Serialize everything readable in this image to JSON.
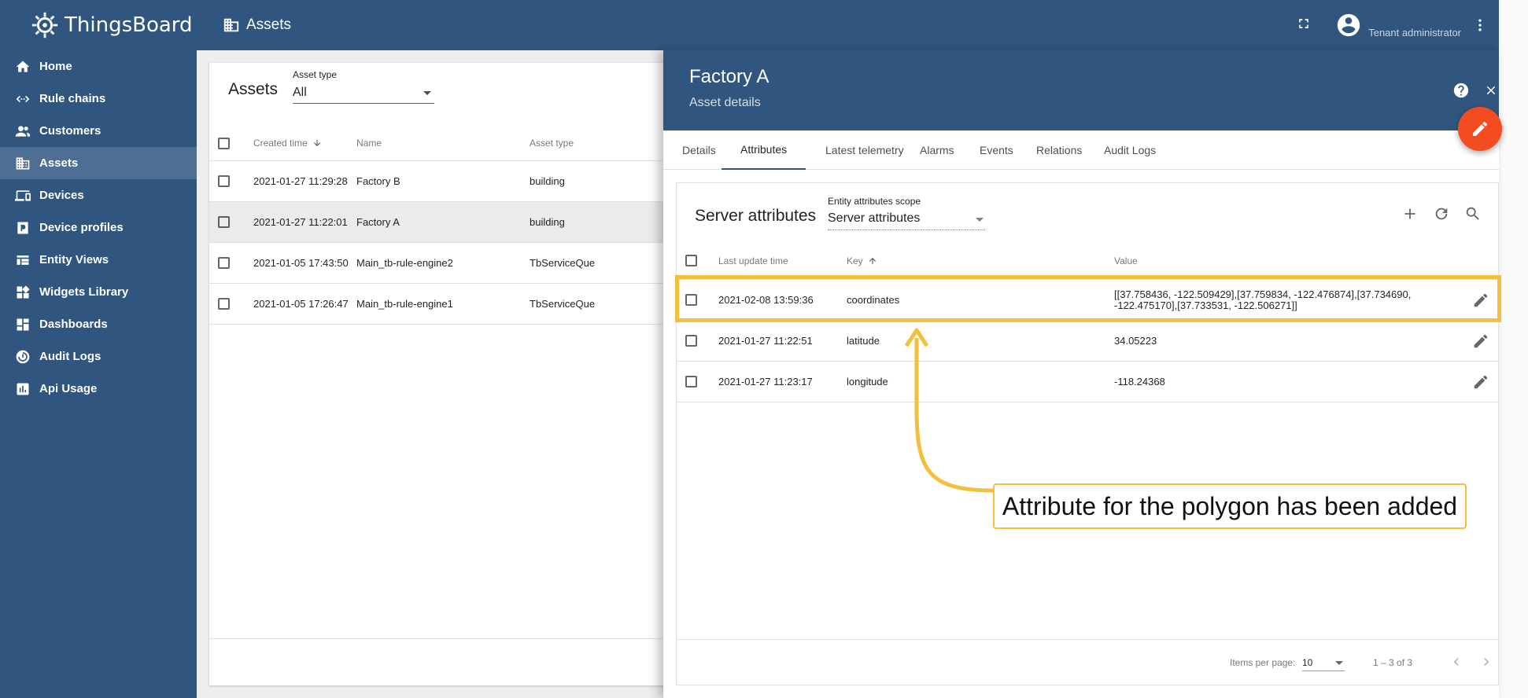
{
  "app": {
    "name": "ThingsBoard",
    "page_title": "Assets",
    "user_role": "Tenant administrator"
  },
  "sidebar": {
    "items": [
      {
        "label": "Home",
        "icon": "home-icon"
      },
      {
        "label": "Rule chains",
        "icon": "rule-chains-icon"
      },
      {
        "label": "Customers",
        "icon": "customers-icon"
      },
      {
        "label": "Assets",
        "icon": "assets-icon",
        "active": true
      },
      {
        "label": "Devices",
        "icon": "devices-icon"
      },
      {
        "label": "Device profiles",
        "icon": "device-profiles-icon"
      },
      {
        "label": "Entity Views",
        "icon": "entity-views-icon"
      },
      {
        "label": "Widgets Library",
        "icon": "widgets-library-icon"
      },
      {
        "label": "Dashboards",
        "icon": "dashboards-icon"
      },
      {
        "label": "Audit Logs",
        "icon": "audit-logs-icon"
      },
      {
        "label": "Api Usage",
        "icon": "api-usage-icon"
      }
    ]
  },
  "assets": {
    "title": "Assets",
    "type_label": "Asset type",
    "type_value": "All",
    "columns": [
      "Created time",
      "Name",
      "Asset type"
    ],
    "rows": [
      {
        "created": "2021-01-27 11:29:28",
        "name": "Factory B",
        "type": "building"
      },
      {
        "created": "2021-01-27 11:22:01",
        "name": "Factory A",
        "type": "building"
      },
      {
        "created": "2021-01-05 17:43:50",
        "name": "Main_tb-rule-engine2",
        "type": "TbServiceQue"
      },
      {
        "created": "2021-01-05 17:26:47",
        "name": "Main_tb-rule-engine1",
        "type": "TbServiceQue"
      }
    ]
  },
  "details": {
    "title": "Factory A",
    "subtitle": "Asset details",
    "tabs": [
      "Details",
      "Attributes",
      "Latest telemetry",
      "Alarms",
      "Events",
      "Relations",
      "Audit Logs"
    ],
    "active_tab": "Attributes",
    "attributes": {
      "title": "Server attributes",
      "scope_label": "Entity attributes scope",
      "scope_value": "Server attributes",
      "columns": [
        "Last update time",
        "Key",
        "Value"
      ],
      "rows": [
        {
          "time": "2021-02-08 13:59:36",
          "key": "coordinates",
          "value": "[[37.758436, -122.509429],[37.759834, -122.476874],[37.734690, -122.475170],[37.733531, -122.506271]]"
        },
        {
          "time": "2021-01-27 11:22:51",
          "key": "latitude",
          "value": "34.05223"
        },
        {
          "time": "2021-01-27 11:23:17",
          "key": "longitude",
          "value": "-118.24368"
        }
      ],
      "paginator": {
        "label": "Items per page:",
        "page_size": "10",
        "range": "1 – 3 of 3"
      }
    }
  },
  "annotation": {
    "text": "Attribute for the polygon has been added",
    "color": "#f2c03c"
  },
  "colors": {
    "primary": "#305680",
    "accent": "#f44c21"
  }
}
